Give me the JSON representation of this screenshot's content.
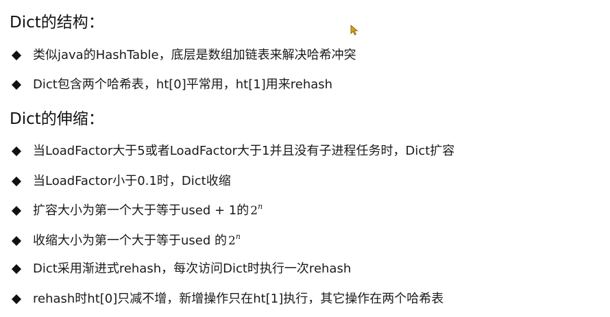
{
  "sections": [
    {
      "heading": "Dict的结构：",
      "items": [
        "类似java的HashTable，底层是数组加链表来解决哈希冲突",
        "Dict包含两个哈希表，ht[0]平常用，ht[1]用来rehash"
      ]
    },
    {
      "heading": "Dict的伸缩：",
      "items": [
        "当LoadFactor大于5或者LoadFactor大于1并且没有子进程任务时，Dict扩容",
        "当LoadFactor小于0.1时，Dict收缩",
        "扩容大小为第一个大于等于used + 1的",
        "收缩大小为第一个大于等于used 的",
        "Dict采用渐进式rehash，每次访问Dict时执行一次rehash",
        "rehash时ht[0]只减不增，新增操作只在ht[1]执行，其它操作在两个哈希表"
      ]
    }
  ],
  "math": {
    "base": "2",
    "exponent": "n"
  },
  "icons": {
    "bullet": "diamond-bullet-icon",
    "cursor": "mouse-pointer-icon"
  },
  "colors": {
    "text": "#1a1a1a",
    "bullet": "#111111",
    "cursor": "#d4a017"
  }
}
